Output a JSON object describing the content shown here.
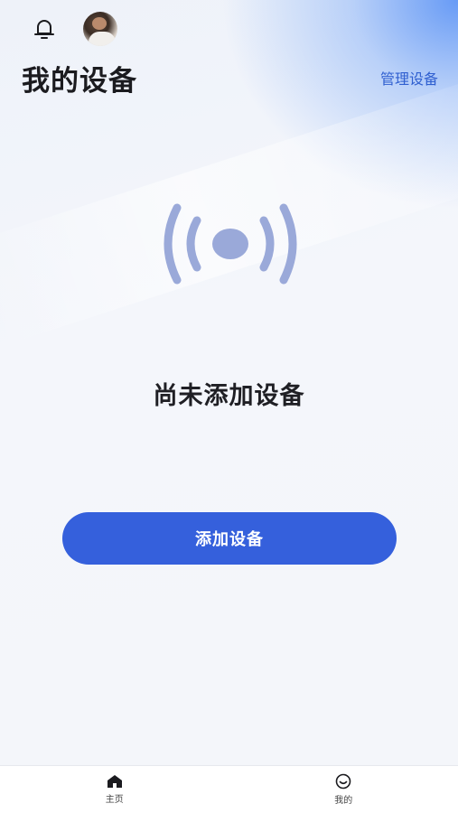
{
  "header": {
    "title": "我的设备",
    "manage_label": "管理设备"
  },
  "icons": {
    "bell": "bell-icon",
    "avatar": "user-avatar",
    "signal": "signal-broadcast-icon",
    "home": "home-icon",
    "profile": "smile-face-icon"
  },
  "empty_state": {
    "message": "尚未添加设备",
    "button_label": "添加设备"
  },
  "tabbar": {
    "items": [
      {
        "label": "主页",
        "icon": "home-icon",
        "active": true
      },
      {
        "label": "我的",
        "icon": "smile-face-icon",
        "active": false
      }
    ]
  },
  "colors": {
    "accent": "#3560dc",
    "link": "#2f5fd0",
    "signal": "#9aa9d9",
    "title": "#1b1b1f"
  }
}
